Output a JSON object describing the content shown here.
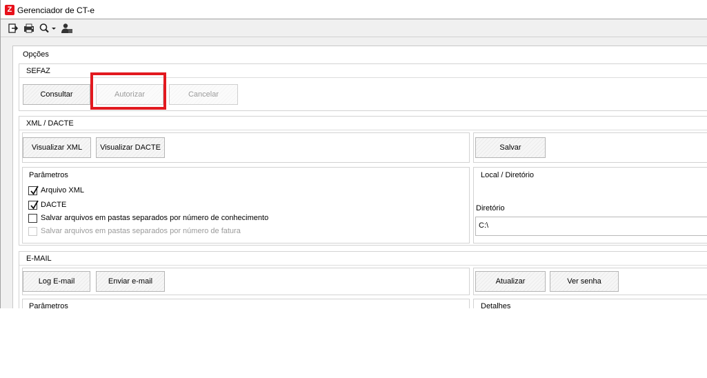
{
  "window": {
    "title": "Gerenciador de CT-e",
    "icon_letter": "Z",
    "accent_color": "#e8111b"
  },
  "toolbar": {
    "icons": [
      "exit-icon",
      "printer-icon",
      "search-icon",
      "user-icon"
    ]
  },
  "options": {
    "title": "Opções",
    "sefaz": {
      "title": "SEFAZ",
      "consultar_label": "Consultar",
      "autorizar_label": "Autorizar",
      "cancelar_label": "Cancelar"
    },
    "xml_dacte": {
      "title": "XML / DACTE",
      "visualizar_xml_label": "Visualizar XML",
      "visualizar_dacte_label": "Visualizar DACTE",
      "salvar_label": "Salvar",
      "parametros": {
        "title": "Parâmetros",
        "items": [
          {
            "label": "Arquivo XML",
            "checked": true,
            "enabled": true
          },
          {
            "label": "DACTE",
            "checked": true,
            "enabled": true
          },
          {
            "label": "Salvar arquivos em pastas separados por número de conhecimento",
            "checked": false,
            "enabled": true
          },
          {
            "label": "Salvar arquivos em pastas separados por número de fatura",
            "checked": false,
            "enabled": false
          }
        ]
      },
      "local": {
        "title": "Local / Diretório",
        "diretorio_label": "Diretório",
        "diretorio_value": "C:\\"
      }
    },
    "email": {
      "title": "E-MAIL",
      "log_label": "Log E-mail",
      "enviar_label": "Enviar e-mail",
      "atualizar_label": "Atualizar",
      "ver_senha_label": "Ver senha",
      "parametros_title": "Parâmetros",
      "detalhes_title": "Detalhes"
    }
  },
  "highlight_color": "#e2191f"
}
